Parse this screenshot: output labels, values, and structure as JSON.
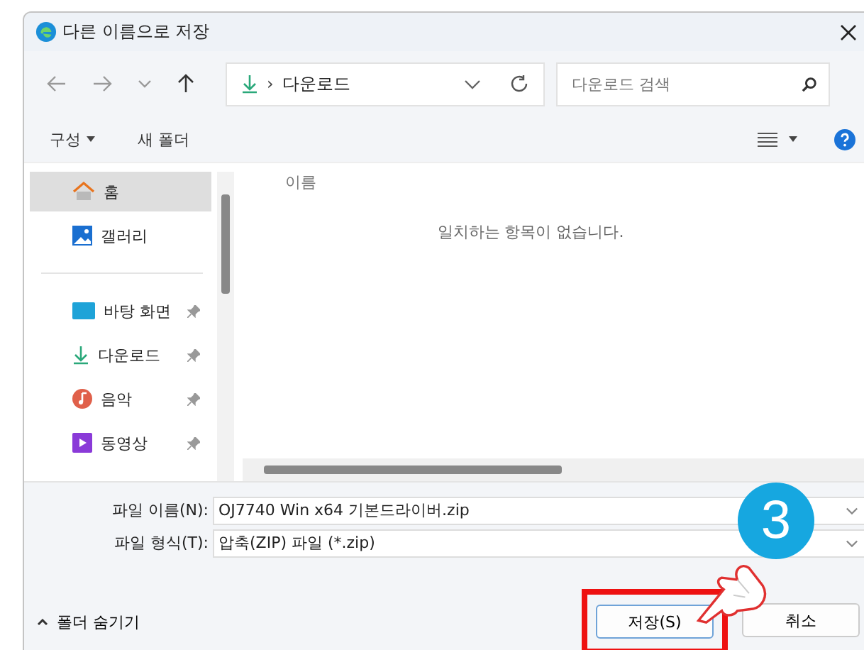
{
  "window": {
    "title": "다른 이름으로 저장"
  },
  "address_bar": {
    "path": "다운로드",
    "separator": "›"
  },
  "search": {
    "placeholder": "다운로드 검색"
  },
  "toolbar": {
    "organize": "구성",
    "new_folder": "새 폴더"
  },
  "sidebar": {
    "items": [
      {
        "label": "홈",
        "kind": "home",
        "selected": true,
        "pinned": false
      },
      {
        "label": "갤러리",
        "kind": "gallery",
        "selected": false,
        "pinned": false
      },
      {
        "label": "바탕 화면",
        "kind": "desktop",
        "selected": false,
        "pinned": true
      },
      {
        "label": "다운로드",
        "kind": "download",
        "selected": false,
        "pinned": true
      },
      {
        "label": "음악",
        "kind": "music",
        "selected": false,
        "pinned": true
      },
      {
        "label": "동영상",
        "kind": "video",
        "selected": false,
        "pinned": true
      }
    ]
  },
  "file_list": {
    "column": "이름",
    "empty_message": "일치하는 항목이 없습니다."
  },
  "fields": [
    {
      "label": "파일 이름(N):",
      "value": "OJ7740 Win x64 기본드라이버.zip"
    },
    {
      "label": "파일 형식(T):",
      "value": "압축(ZIP) 파일 (*.zip)"
    }
  ],
  "hide_folders": "폴더 숨기기",
  "buttons": [
    {
      "label": "저장(S)",
      "highlighted": true
    },
    {
      "label": "취소",
      "highlighted": false
    }
  ],
  "step_badge": "3"
}
